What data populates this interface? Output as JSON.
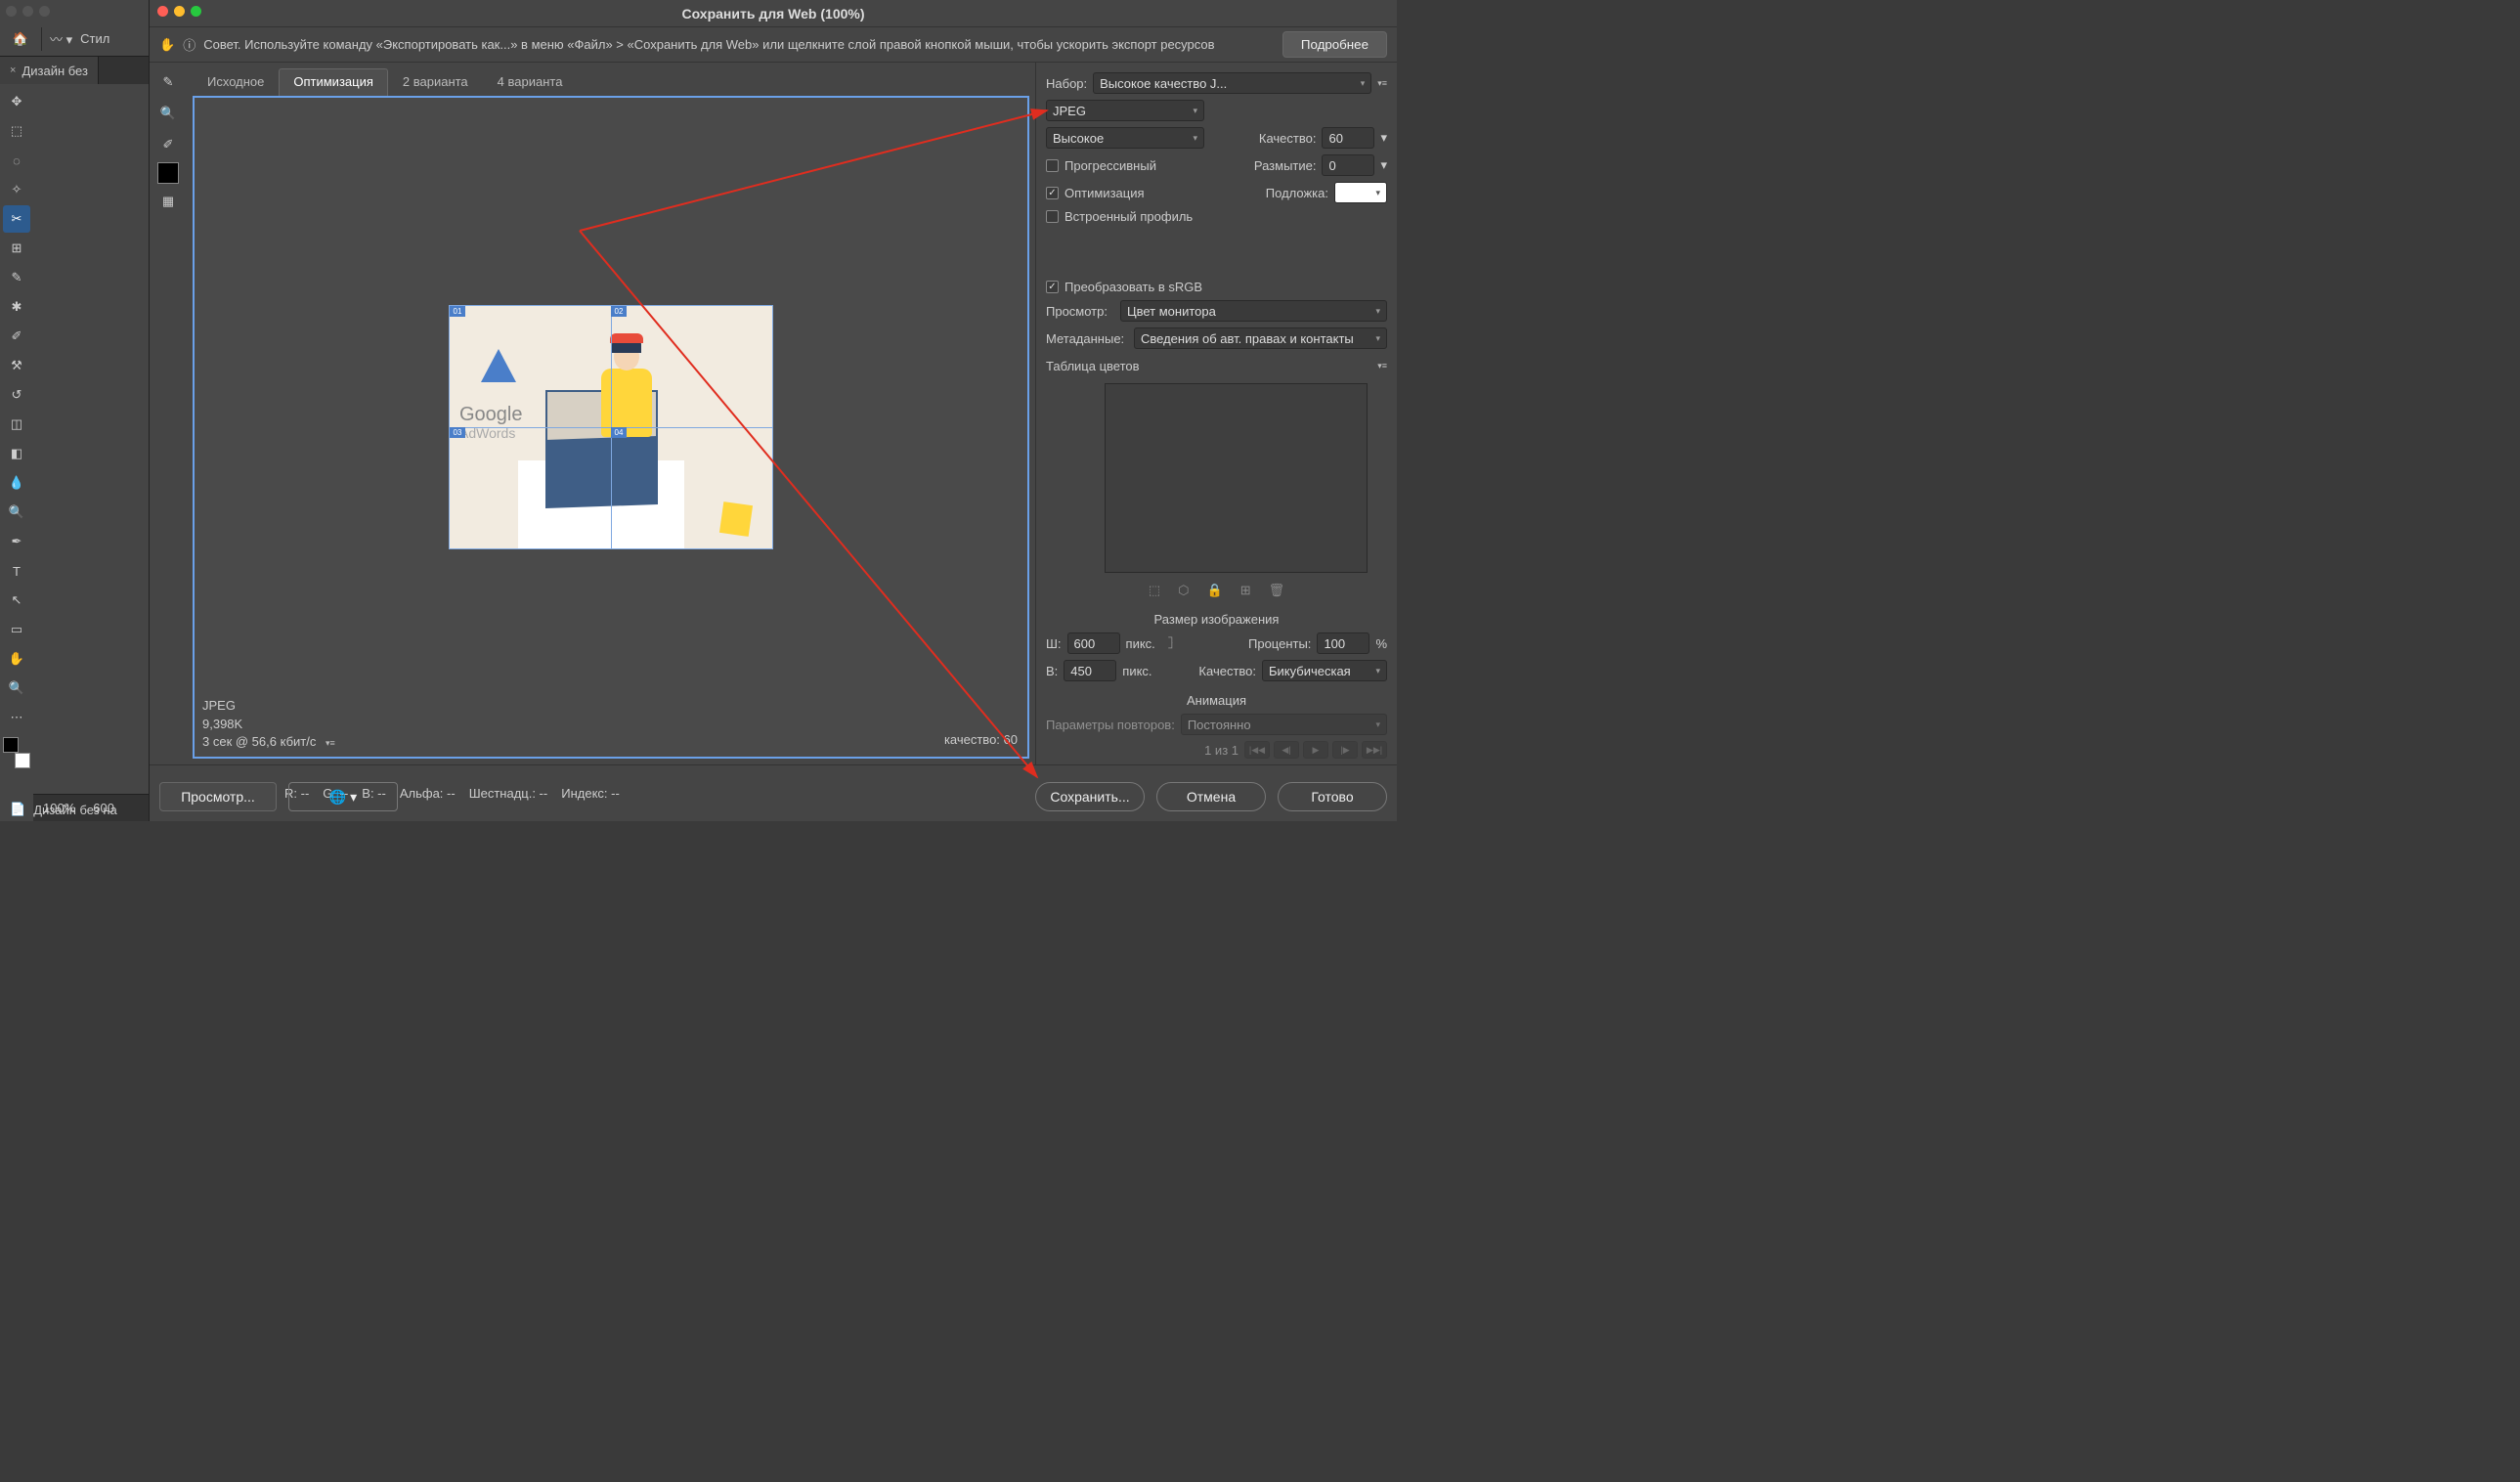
{
  "ps": {
    "style_label": "Стил",
    "tab": "Дизайн без",
    "zoom": "100%",
    "dim": "600",
    "status_file": "Дизайн без на"
  },
  "dialog": {
    "title": "Сохранить для Web (100%)",
    "hint": "Совет. Используйте команду «Экспортировать как...» в меню «Файл» > «Сохранить для Web» или щелкните слой правой кнопкой мыши, чтобы ускорить экспорт ресурсов",
    "more": "Подробнее",
    "tabs": {
      "original": "Исходное",
      "optimized": "Оптимизация",
      "twoup": "2 варианта",
      "fourup": "4 варианта"
    },
    "preview_info": {
      "format": "JPEG",
      "size": "9,398K",
      "time": "3 сек @ 56,6 кбит/с",
      "quality": "качество: 60"
    },
    "ill": {
      "google": "Google",
      "adwords": "AdWords"
    }
  },
  "settings": {
    "preset_label": "Набор:",
    "preset": "Высокое качество J...",
    "format": "JPEG",
    "quality_preset": "Высокое",
    "quality_label": "Качество:",
    "quality": "60",
    "progressive": "Прогрессивный",
    "blur_label": "Размытие:",
    "blur": "0",
    "optimization": "Оптимизация",
    "matte_label": "Подложка:",
    "embedded": "Встроенный профиль",
    "srgb": "Преобразовать в sRGB",
    "preview_label": "Просмотр:",
    "preview": "Цвет монитора",
    "meta_label": "Метаданные:",
    "meta": "Сведения об авт. правах и контакты",
    "color_table": "Таблица цветов",
    "image_size": "Размер изображения",
    "w_label": "Ш:",
    "w": "600",
    "h_label": "В:",
    "h": "450",
    "px": "пикс.",
    "percent_label": "Проценты:",
    "percent": "100",
    "percent_sym": "%",
    "q_label": "Качество:",
    "q_algo": "Бикубическая",
    "animation": "Анимация",
    "loop_label": "Параметры повторов:",
    "loop": "Постоянно",
    "frame": "1 из 1"
  },
  "footer": {
    "zoom": "100%",
    "preview": "Просмотр...",
    "r": "R: --",
    "g": "G: --",
    "b": "B: --",
    "alpha": "Альфа: --",
    "hex": "Шестнадц.: --",
    "index": "Индекс: --",
    "save": "Сохранить...",
    "cancel": "Отмена",
    "done": "Готово"
  }
}
